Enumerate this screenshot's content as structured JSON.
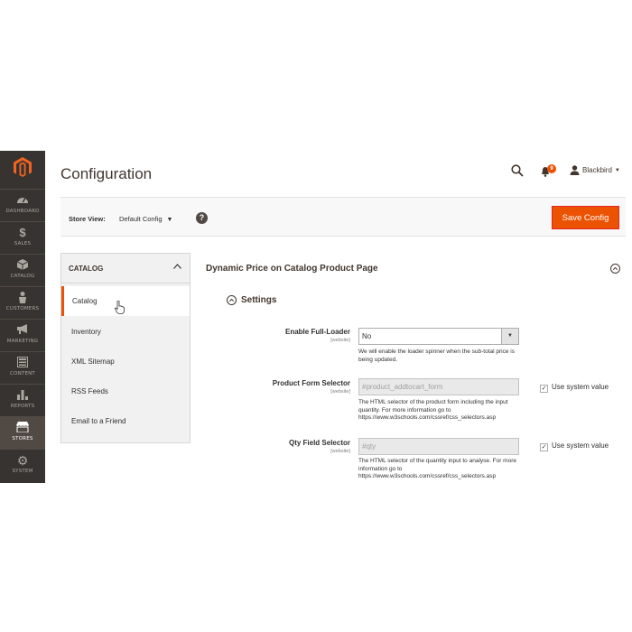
{
  "sidebar": {
    "logo": "magento-logo",
    "items": [
      {
        "label": "DASHBOARD",
        "icon": "dashboard-icon"
      },
      {
        "label": "SALES",
        "icon": "dollar-icon"
      },
      {
        "label": "CATALOG",
        "icon": "box-icon"
      },
      {
        "label": "CUSTOMERS",
        "icon": "person-icon"
      },
      {
        "label": "MARKETING",
        "icon": "megaphone-icon"
      },
      {
        "label": "CONTENT",
        "icon": "layout-icon"
      },
      {
        "label": "REPORTS",
        "icon": "bar-chart-icon"
      },
      {
        "label": "STORES",
        "icon": "store-icon"
      },
      {
        "label": "SYSTEM",
        "icon": "gear-icon"
      }
    ],
    "active": "STORES"
  },
  "header": {
    "title": "Configuration",
    "notification_count": "9",
    "user_name": "Blackbird"
  },
  "store_bar": {
    "label": "Store View:",
    "value": "Default Config",
    "help": "?",
    "save_label": "Save Config"
  },
  "tabs": {
    "group_label": "CATALOG",
    "items": [
      {
        "label": "Catalog",
        "active": true
      },
      {
        "label": "Inventory"
      },
      {
        "label": "XML Sitemap"
      },
      {
        "label": "RSS Feeds"
      },
      {
        "label": "Email to a Friend"
      }
    ]
  },
  "section": {
    "title": "Dynamic Price on Catalog Product Page",
    "group_title": "Settings",
    "fields": [
      {
        "label": "Enable Full-Loader",
        "scope": "[website]",
        "value": "No",
        "note": "We will enable the loader spinner when the sub-total price is being updated."
      },
      {
        "label": "Product Form Selector",
        "scope": "[website]",
        "placeholder": "#product_addtocart_form",
        "note": "The HTML selector of the product form including the input quantity. For more information go to https://www.w3schools.com/cssref/css_selectors.asp",
        "use_system": "Use system value"
      },
      {
        "label": "Qty Field Selector",
        "scope": "[website]",
        "placeholder": "#qty",
        "note": "The HTML selector of the quantity input to analyse. For more information go to https://www.w3schools.com/cssref/css_selectors.asp",
        "use_system": "Use system value"
      }
    ]
  },
  "colors": {
    "accent": "#eb5202",
    "sidebar_bg": "#373330"
  }
}
